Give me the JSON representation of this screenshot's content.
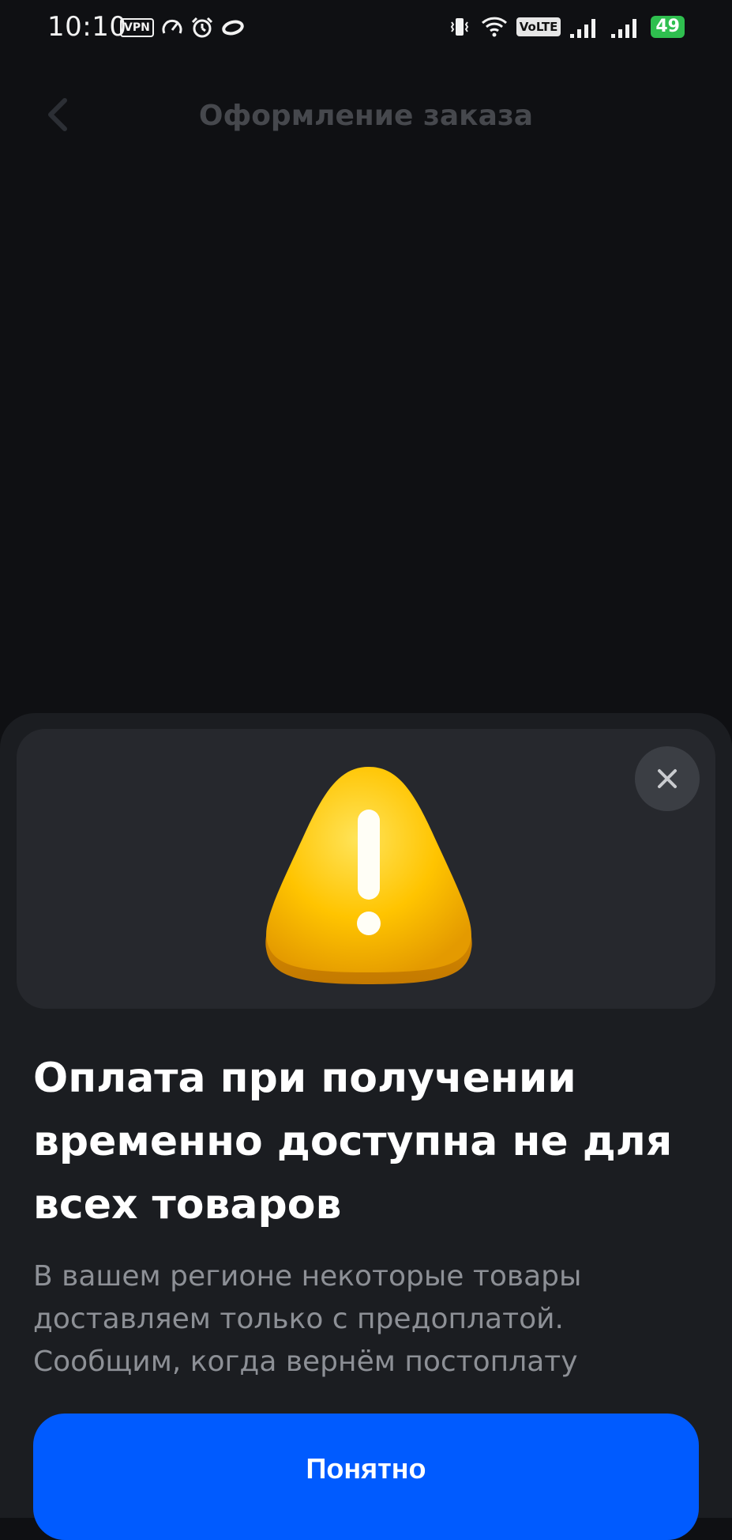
{
  "status_bar": {
    "time": "10:10",
    "vpn_label": "VPN",
    "volte_label": "VoLTE",
    "battery_level": "49",
    "icons": [
      "vpn-icon",
      "speed-icon",
      "alarm-icon",
      "ring-icon",
      "vibrate-icon",
      "wifi-icon",
      "volte-icon",
      "signal-icon",
      "signal-icon",
      "battery-icon"
    ]
  },
  "header": {
    "title": "Оформление заказа",
    "back_icon": "chevron-left-icon"
  },
  "sheet": {
    "close_icon": "close-icon",
    "illustration_icon": "warning-icon",
    "title": "Оплата при получении временно доступна не для всех товаров",
    "body": "В вашем регионе некоторые товары доставляем только с предоплатой. Сообщим, когда вернём постоплату",
    "primary_button": "Понятно"
  },
  "colors": {
    "background": "#0f1013",
    "sheet": "#1b1d21",
    "hero": "#26282d",
    "accent": "#005bff",
    "warning": "#ffc400",
    "battery": "#2fbf4f"
  }
}
